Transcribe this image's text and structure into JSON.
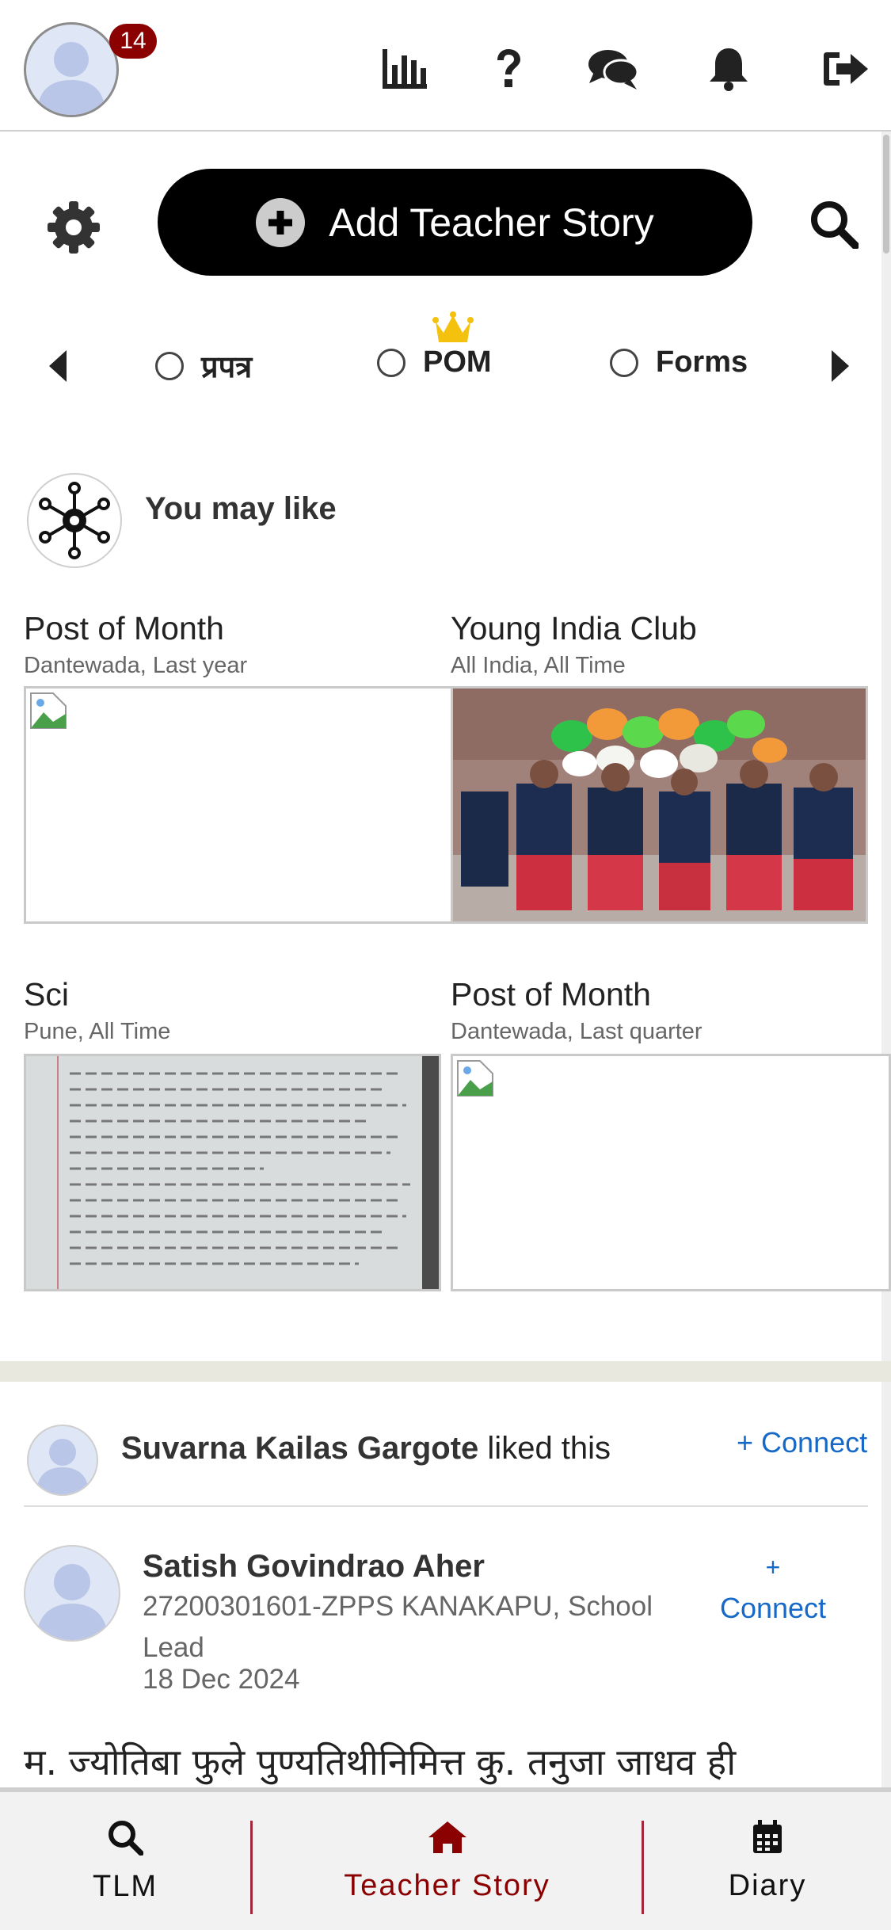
{
  "header": {
    "notification_count": "14",
    "icons": [
      "bar-chart-icon",
      "question-icon",
      "chat-icon",
      "bell-icon",
      "logout-icon"
    ]
  },
  "actions": {
    "add_story_label": "Add Teacher Story"
  },
  "filters": {
    "options": [
      "प्रपत्र",
      "POM",
      "Forms"
    ]
  },
  "you_may_like": {
    "title": "You may like",
    "cards": [
      {
        "title": "Post of Month",
        "subtitle": "Dantewada, Last year"
      },
      {
        "title": "Young India Club",
        "subtitle": "All India, All Time"
      },
      {
        "title": "Sci",
        "subtitle": "Pune, All Time"
      },
      {
        "title": "Post of Month",
        "subtitle": "Dantewada, Last quarter"
      }
    ]
  },
  "feed": {
    "liker_name": "Suvarna Kailas Gargote",
    "liked_suffix": "liked this",
    "connect_label": "+ Connect",
    "connect_plus": "+",
    "connect_word": "Connect",
    "author_name": "Satish Govindrao Aher",
    "author_school": "27200301601-ZPPS KANAKAPU, School Lead",
    "date": "18 Dec 2024",
    "story_excerpt": "म. ज्योतिबा फुले पुण्यतिथीनिमित्त कु. तनुजा जाधव ही"
  },
  "bottom_nav": {
    "tlm": "TLM",
    "teacher_story": "Teacher Story",
    "diary": "Diary"
  },
  "colors": {
    "accent_dark_red": "#8b0000",
    "link_blue": "#1769c7",
    "active_nav": "#8b0000"
  }
}
